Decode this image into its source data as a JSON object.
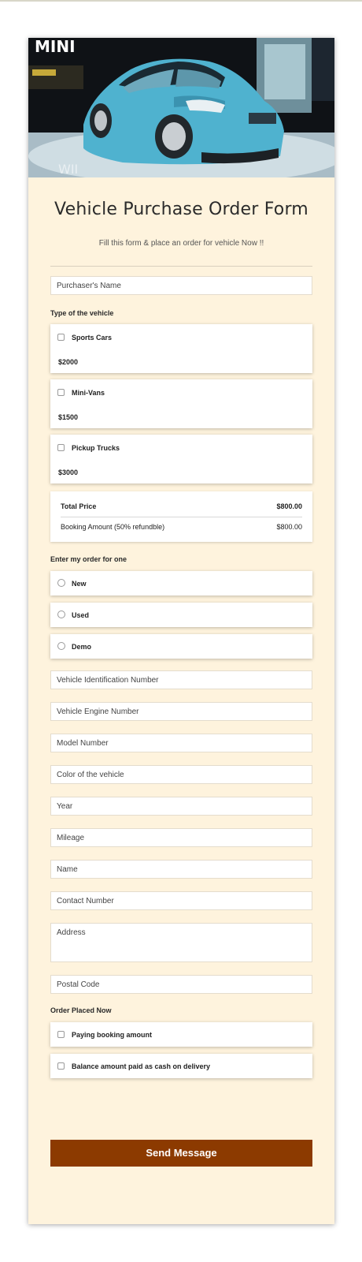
{
  "form": {
    "title": "Vehicle Purchase Order Form",
    "subtitle": "Fill this form & place an order for vehicle Now !!",
    "hero_sign_text": "MINI",
    "hero_floor_text": "WII",
    "purchaser_name_placeholder": "Purchaser's Name",
    "vehicle_type_label": "Type of the vehicle",
    "vehicle_types": [
      {
        "name": "Sports Cars",
        "price": "$2000"
      },
      {
        "name": "Mini-Vans",
        "price": "$1500"
      },
      {
        "name": "Pickup Trucks",
        "price": "$3000"
      }
    ],
    "summary": {
      "total_label": "Total Price",
      "total_value": "$800.00",
      "booking_label": "Booking Amount (50% refundble)",
      "booking_value": "$800.00"
    },
    "order_for_label": "Enter my order for one",
    "order_for_options": [
      "New",
      "Used",
      "Demo"
    ],
    "fields": {
      "vin": "Vehicle Identification Number",
      "engine": "Vehicle Engine Number",
      "model": "Model Number",
      "color": "Color of the vehicle",
      "year": "Year",
      "mileage": "Mileage",
      "name": "Name",
      "contact": "Contact Number",
      "address": "Address",
      "postal": "Postal Code"
    },
    "order_placed_label": "Order Placed Now",
    "order_placed_options": [
      "Paying booking amount",
      "Balance amount paid as cash on delivery"
    ],
    "submit_label": "Send Message"
  },
  "colors": {
    "card_background": "#fef3dd",
    "submit_button": "#8c3a00",
    "car_body": "#4fb2cf"
  }
}
